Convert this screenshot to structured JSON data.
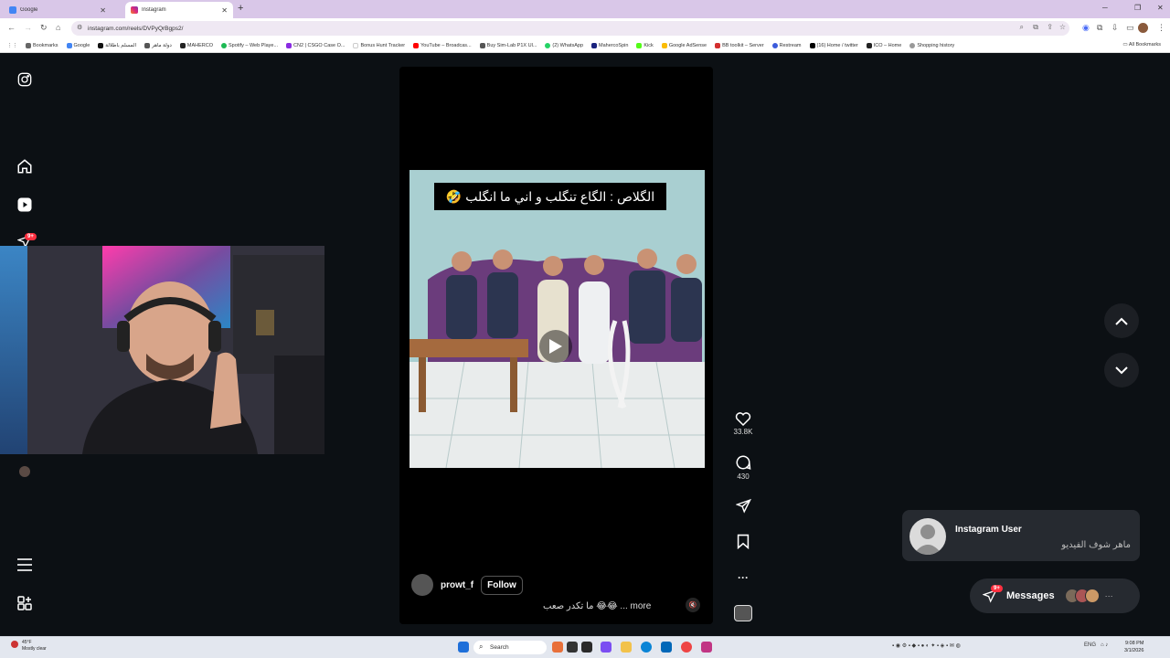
{
  "browser": {
    "tabs": [
      {
        "title": "Google",
        "active": false,
        "favicon_color": "#4285f4"
      },
      {
        "title": "Instagram",
        "active": true,
        "favicon_color": "#e1306c"
      }
    ],
    "new_tab_symbol": "+",
    "url": "instagram.com/reels/DVPyQrBgps2/",
    "bookmarks": [
      {
        "label": "Bookmarks",
        "color": "#666"
      },
      {
        "label": "Google",
        "color": "#4285f4"
      },
      {
        "label": "المسلم باطلالة",
        "color": "#111"
      },
      {
        "label": "دولة ماهر",
        "color": "#555"
      },
      {
        "label": "MAHERCO",
        "color": "#222"
      },
      {
        "label": "Spotify – Web Playe...",
        "color": "#1db954"
      },
      {
        "label": "CN2 | CSGO Case O...",
        "color": "#8a2be2"
      },
      {
        "label": "Bonus Hunt Tracker",
        "color": "#fff"
      },
      {
        "label": "YouTube – Broadcas...",
        "color": "#ff0000"
      },
      {
        "label": "Buy Sim-Lab P1X Ul...",
        "color": "#555"
      },
      {
        "label": "(2) WhatsApp",
        "color": "#25d366"
      },
      {
        "label": "MahercoSpin",
        "color": "#1a237e"
      },
      {
        "label": "Kick",
        "color": "#53fc18"
      },
      {
        "label": "Google AdSense",
        "color": "#fbbc05"
      },
      {
        "label": "BB toolkit – Server",
        "color": "#d32f2f"
      },
      {
        "label": "Restream",
        "color": "#3b5bdb"
      },
      {
        "label": "(16) Home / twitter",
        "color": "#000"
      },
      {
        "label": "ICO – Home",
        "color": "#222"
      },
      {
        "label": "Shopping history",
        "color": "#999"
      }
    ],
    "all_bookmarks": "All Bookmarks"
  },
  "reel": {
    "caption_overlay": "الگلاص : الگاع تنگلب و اني ما انگلب 🤣",
    "author": "prowt_f",
    "follow_label": "Follow",
    "description": "ما تكدر صعب 😂😂 ... more",
    "likes": "33.8K",
    "comments": "430"
  },
  "notification": {
    "name": "Instagram User",
    "message": "ماهر شوف الفيديو"
  },
  "messages": {
    "label": "Messages",
    "badge": "9+",
    "more": "···"
  },
  "sidebar": {
    "notifications_badge": "9+"
  },
  "taskbar": {
    "weather_temp": "45°F",
    "weather_text": "Mostly clear",
    "search_label": "Search",
    "lang": "ENG",
    "time": "9:08 PM",
    "date": "3/1/2026"
  },
  "colors": {
    "ig_bg": "#0c1014",
    "badge": "#ff3040",
    "tabbar": "#d9c7e8"
  }
}
